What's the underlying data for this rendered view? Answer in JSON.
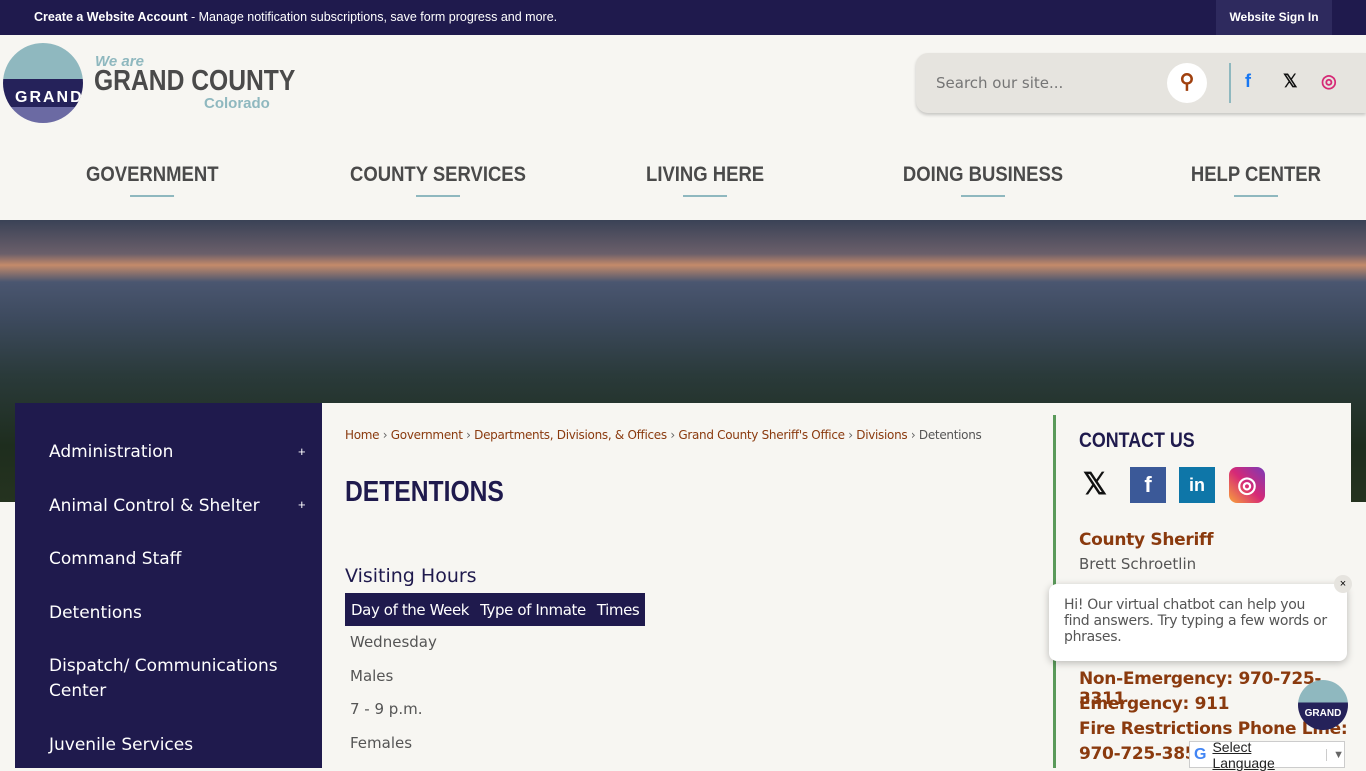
{
  "topbar": {
    "bold": "Create a Website Account",
    "text": " - Manage notification subscriptions, save form progress and more.",
    "signin": "Website Sign In"
  },
  "logo": {
    "badge": "GRAND",
    "line1": "We are",
    "line2": "GRAND COUNTY",
    "line3": "Colorado"
  },
  "search": {
    "placeholder": "Search our site..."
  },
  "social": [
    "facebook-icon",
    "x-icon",
    "instagram-icon"
  ],
  "nav": [
    "GOVERNMENT",
    "COUNTY SERVICES",
    "LIVING HERE",
    "DOING BUSINESS",
    "HELP CENTER"
  ],
  "sidebar": [
    "Administration",
    "Animal Control & Shelter",
    "Command Staff",
    "Detentions",
    "Dispatch/ Communications Center",
    "Juvenile Services"
  ],
  "breadcrumb": [
    "Home",
    "Government",
    "Departments, Divisions, & Offices",
    "Grand County Sheriff's Office",
    "Divisions",
    "Detentions"
  ],
  "page_title": "DETENTIONS",
  "visiting": {
    "heading": "Visiting Hours",
    "headers": [
      "Day of the Week",
      "Type of Inmate",
      "Times"
    ],
    "rows": [
      "Wednesday",
      "Males",
      "7 - 9 p.m.",
      "Females"
    ]
  },
  "contact": {
    "title": "CONTACT US",
    "role": "County Sheriff",
    "name": "Brett Schroetlin",
    "non_emergency": "Non-Emergency: 970-725-3311",
    "emergency": "Emergency: 911",
    "fire_label": "Fire Restrictions Phone Line:",
    "fire_phone": "970-725-3852"
  },
  "chat": {
    "message": "Hi! Our virtual chatbot can help you find answers. Try typing a few words or phrases.",
    "close": "×",
    "avatar": "GRAND"
  },
  "translate": {
    "label": "Select Language",
    "arrow": "▼"
  },
  "colors": {
    "navy": "#1f1a4d",
    "accent": "#8a3a0e",
    "teal": "#8fb8bf"
  }
}
